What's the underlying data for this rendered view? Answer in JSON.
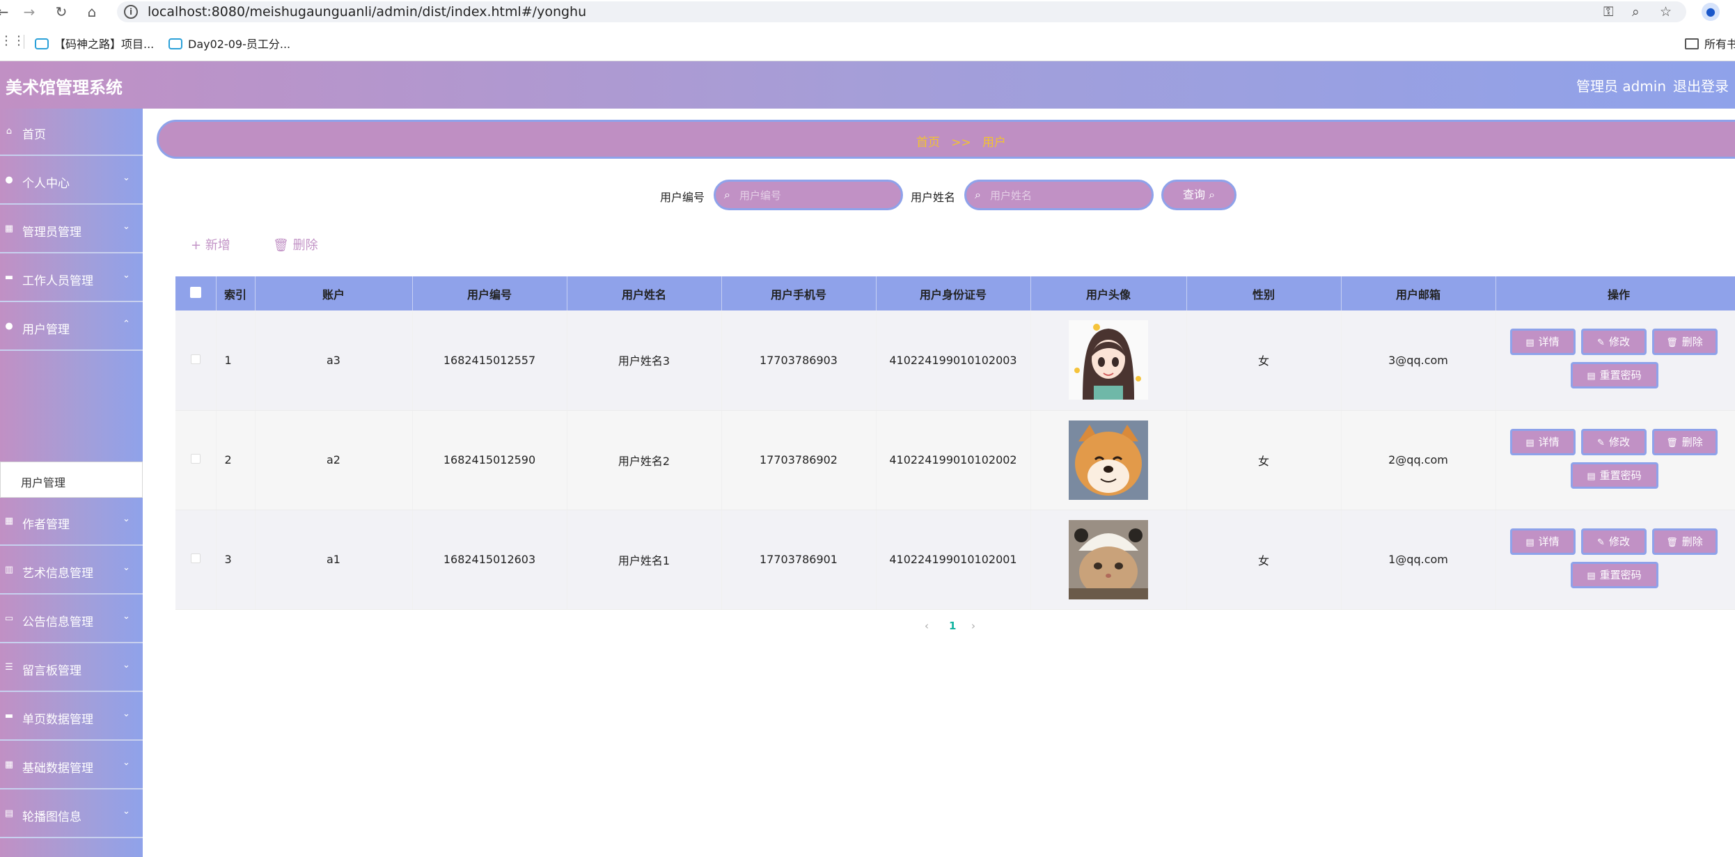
{
  "browser": {
    "url": "localhost:8080/meishugaunguanli/admin/dist/index.html#/yonghu",
    "bookmarks": [
      "【码神之路】项目...",
      "Day02-09-员工分...",
      "所有书"
    ]
  },
  "header": {
    "title": "美术馆管理系统",
    "user_label": "管理员 admin",
    "logout_label": "退出登录"
  },
  "sidebar": {
    "items": [
      {
        "label": "首页",
        "icon": "home-icon"
      },
      {
        "label": "个人中心",
        "icon": "user-icon"
      },
      {
        "label": "管理员管理",
        "icon": "grid-icon"
      },
      {
        "label": "工作人员管理",
        "icon": "ticket-icon"
      },
      {
        "label": "用户管理",
        "icon": "user-icon"
      },
      {
        "label": "作者管理",
        "icon": "grid-icon"
      },
      {
        "label": "艺术信息管理",
        "icon": "bar-chart-icon"
      },
      {
        "label": "公告信息管理",
        "icon": "message-icon"
      },
      {
        "label": "留言板管理",
        "icon": "list-icon"
      },
      {
        "label": "单页数据管理",
        "icon": "monitor-icon"
      },
      {
        "label": "基础数据管理",
        "icon": "grid-icon"
      },
      {
        "label": "轮播图信息",
        "icon": "data-icon"
      }
    ],
    "active_sub": "用户管理"
  },
  "breadcrumb": {
    "home": "首页",
    "separator": ">>",
    "current": "用户"
  },
  "search": {
    "user_no_label": "用户编号",
    "user_no_placeholder": "用户编号",
    "user_name_label": "用户姓名",
    "user_name_placeholder": "用户姓名",
    "query_label": "查询"
  },
  "toolbar": {
    "add_label": "新增",
    "delete_label": "删除"
  },
  "table": {
    "columns": [
      "索引",
      "账户",
      "用户编号",
      "用户姓名",
      "用户手机号",
      "用户身份证号",
      "用户头像",
      "性别",
      "用户邮箱",
      "操作"
    ],
    "rows": [
      {
        "index": "1",
        "account": "a3",
        "user_no": "1682415012557",
        "name": "用户姓名3",
        "phone": "17703786903",
        "id_card": "410224199010102003",
        "avatar": "anime-girl",
        "gender": "女",
        "email": "3@qq.com"
      },
      {
        "index": "2",
        "account": "a2",
        "user_no": "1682415012590",
        "name": "用户姓名2",
        "phone": "17703786902",
        "id_card": "410224199010102002",
        "avatar": "shiba-dog",
        "gender": "女",
        "email": "2@qq.com"
      },
      {
        "index": "3",
        "account": "a1",
        "user_no": "1682415012603",
        "name": "用户姓名1",
        "phone": "17703786901",
        "id_card": "410224199010102001",
        "avatar": "cat-hat",
        "gender": "女",
        "email": "1@qq.com"
      }
    ],
    "actions": {
      "detail": "详情",
      "edit": "修改",
      "delete": "删除",
      "reset": "重置密码"
    }
  },
  "pagination": {
    "current": "1"
  },
  "colors": {
    "accent_pink": "#c191c5",
    "accent_blue": "#8fa2ea",
    "crumb_text": "#f2c230"
  }
}
